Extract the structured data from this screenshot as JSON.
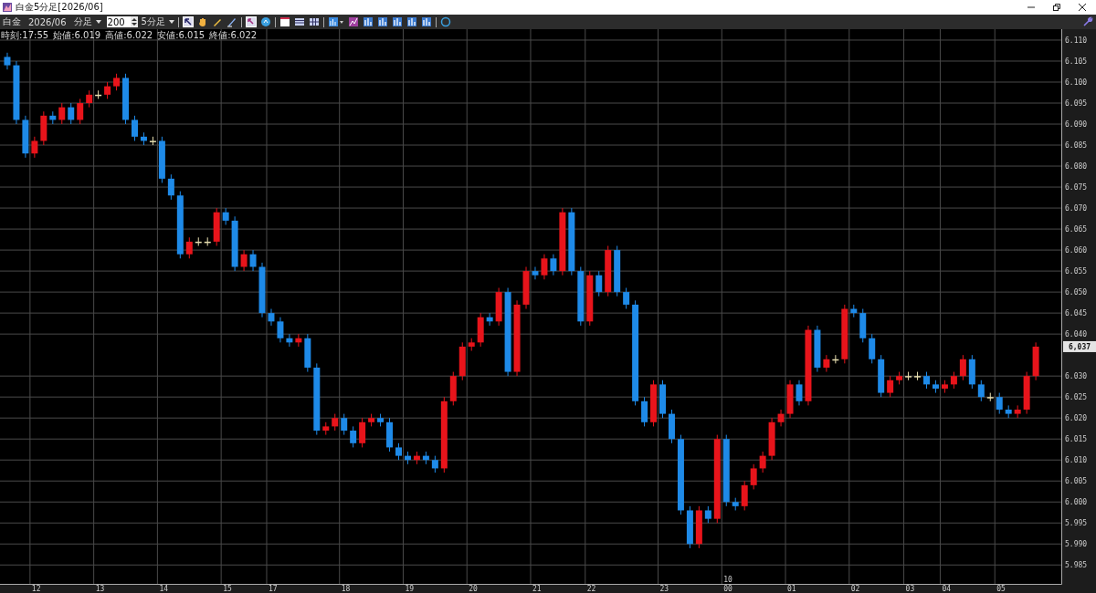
{
  "window": {
    "title": "白金5分足[2026/06]"
  },
  "toolbar": {
    "symbol": "白金",
    "contract": "2026/06",
    "period_unit": "分足",
    "bar_count": "200",
    "period": "5分足"
  },
  "info": [
    "時刻:17:55",
    "始値:6.019",
    "高値:6.022",
    "安値:6.015",
    "終値:6.022"
  ],
  "chart": {
    "last_price": "6,037",
    "chart_data": {
      "type": "candlestick",
      "grid": true,
      "categories": [
        null,
        null,
        null,
        "12",
        null,
        null,
        null,
        null,
        null,
        null,
        "13",
        null,
        null,
        null,
        null,
        null,
        null,
        "14",
        null,
        null,
        null,
        null,
        null,
        null,
        "15",
        null,
        null,
        null,
        null,
        "17",
        null,
        null,
        null,
        null,
        null,
        null,
        null,
        "18",
        null,
        null,
        null,
        null,
        null,
        null,
        "19",
        null,
        null,
        null,
        null,
        null,
        null,
        "20",
        null,
        null,
        null,
        null,
        null,
        null,
        "21",
        null,
        null,
        null,
        null,
        null,
        "22",
        null,
        null,
        null,
        null,
        null,
        null,
        null,
        "23",
        null,
        null,
        null,
        null,
        null,
        null,
        "00",
        null,
        null,
        null,
        null,
        null,
        null,
        "01",
        null,
        null,
        null,
        null,
        null,
        null,
        "02",
        null,
        null,
        null,
        null,
        null,
        "03",
        null,
        null,
        null,
        "04",
        null,
        null,
        null,
        null,
        null,
        "05",
        null,
        null,
        null,
        null
      ],
      "ohlc": [
        [
          6.106,
          6.107,
          6.103,
          6.104
        ],
        [
          6.104,
          6.105,
          6.09,
          6.091
        ],
        [
          6.091,
          6.092,
          6.082,
          6.083
        ],
        [
          6.083,
          6.087,
          6.082,
          6.086
        ],
        [
          6.086,
          6.093,
          6.085,
          6.092
        ],
        [
          6.092,
          6.093,
          6.09,
          6.091
        ],
        [
          6.091,
          6.095,
          6.09,
          6.094
        ],
        [
          6.094,
          6.095,
          6.09,
          6.091
        ],
        [
          6.091,
          6.096,
          6.09,
          6.095
        ],
        [
          6.095,
          6.098,
          6.094,
          6.097
        ],
        [
          6.097,
          6.098,
          6.096,
          6.097
        ],
        [
          6.097,
          6.1,
          6.096,
          6.099
        ],
        [
          6.099,
          6.102,
          6.098,
          6.101
        ],
        [
          6.101,
          6.102,
          6.09,
          6.091
        ],
        [
          6.091,
          6.092,
          6.086,
          6.087
        ],
        [
          6.087,
          6.088,
          6.085,
          6.086
        ],
        [
          6.086,
          6.087,
          6.085,
          6.086
        ],
        [
          6.086,
          6.087,
          6.076,
          6.077
        ],
        [
          6.077,
          6.078,
          6.072,
          6.073
        ],
        [
          6.073,
          6.074,
          6.058,
          6.059
        ],
        [
          6.059,
          6.063,
          6.058,
          6.062
        ],
        [
          6.062,
          6.063,
          6.061,
          6.062
        ],
        [
          6.062,
          6.063,
          6.061,
          6.062
        ],
        [
          6.062,
          6.07,
          6.061,
          6.069
        ],
        [
          6.069,
          6.07,
          6.066,
          6.067
        ],
        [
          6.067,
          6.068,
          6.055,
          6.056
        ],
        [
          6.056,
          6.06,
          6.055,
          6.059
        ],
        [
          6.059,
          6.06,
          6.055,
          6.056
        ],
        [
          6.056,
          6.057,
          6.044,
          6.045
        ],
        [
          6.045,
          6.046,
          6.042,
          6.043
        ],
        [
          6.043,
          6.044,
          6.038,
          6.039
        ],
        [
          6.039,
          6.04,
          6.037,
          6.038
        ],
        [
          6.038,
          6.04,
          6.037,
          6.039
        ],
        [
          6.039,
          6.04,
          6.031,
          6.032
        ],
        [
          6.032,
          6.033,
          6.016,
          6.017
        ],
        [
          6.017,
          6.019,
          6.016,
          6.018
        ],
        [
          6.018,
          6.021,
          6.017,
          6.02
        ],
        [
          6.02,
          6.021,
          6.016,
          6.017
        ],
        [
          6.017,
          6.018,
          6.013,
          6.014
        ],
        [
          6.014,
          6.02,
          6.013,
          6.019
        ],
        [
          6.019,
          6.021,
          6.018,
          6.02
        ],
        [
          6.02,
          6.021,
          6.018,
          6.019
        ],
        [
          6.019,
          6.02,
          6.012,
          6.013
        ],
        [
          6.013,
          6.014,
          6.01,
          6.011
        ],
        [
          6.011,
          6.012,
          6.009,
          6.01
        ],
        [
          6.01,
          6.012,
          6.009,
          6.011
        ],
        [
          6.011,
          6.012,
          6.009,
          6.01
        ],
        [
          6.01,
          6.011,
          6.007,
          6.008
        ],
        [
          6.008,
          6.025,
          6.007,
          6.024
        ],
        [
          6.024,
          6.031,
          6.023,
          6.03
        ],
        [
          6.03,
          6.038,
          6.029,
          6.037
        ],
        [
          6.037,
          6.039,
          6.036,
          6.038
        ],
        [
          6.038,
          6.045,
          6.037,
          6.044
        ],
        [
          6.044,
          6.045,
          6.042,
          6.043
        ],
        [
          6.043,
          6.051,
          6.042,
          6.05
        ],
        [
          6.05,
          6.051,
          6.03,
          6.031
        ],
        [
          6.031,
          6.048,
          6.03,
          6.047
        ],
        [
          6.047,
          6.056,
          6.046,
          6.055
        ],
        [
          6.055,
          6.056,
          6.053,
          6.054
        ],
        [
          6.054,
          6.059,
          6.053,
          6.058
        ],
        [
          6.058,
          6.059,
          6.054,
          6.055
        ],
        [
          6.055,
          6.07,
          6.054,
          6.069
        ],
        [
          6.069,
          6.07,
          6.054,
          6.055
        ],
        [
          6.055,
          6.056,
          6.042,
          6.043
        ],
        [
          6.043,
          6.055,
          6.042,
          6.054
        ],
        [
          6.054,
          6.055,
          6.049,
          6.05
        ],
        [
          6.05,
          6.061,
          6.049,
          6.06
        ],
        [
          6.06,
          6.061,
          6.049,
          6.05
        ],
        [
          6.05,
          6.051,
          6.046,
          6.047
        ],
        [
          6.047,
          6.048,
          6.023,
          6.024
        ],
        [
          6.024,
          6.025,
          6.018,
          6.019
        ],
        [
          6.019,
          6.029,
          6.018,
          6.028
        ],
        [
          6.028,
          6.029,
          6.02,
          6.021
        ],
        [
          6.021,
          6.022,
          6.014,
          6.015
        ],
        [
          6.015,
          6.016,
          5.997,
          5.998
        ],
        [
          5.998,
          5.999,
          5.989,
          5.99
        ],
        [
          5.99,
          5.999,
          5.989,
          5.998
        ],
        [
          5.998,
          5.999,
          5.995,
          5.996
        ],
        [
          5.996,
          6.016,
          5.995,
          6.015
        ],
        [
          6.015,
          6.016,
          5.999,
          6.0
        ],
        [
          6.0,
          6.001,
          5.998,
          5.999
        ],
        [
          5.999,
          6.005,
          5.998,
          6.004
        ],
        [
          6.004,
          6.009,
          6.003,
          6.008
        ],
        [
          6.008,
          6.012,
          6.007,
          6.011
        ],
        [
          6.011,
          6.02,
          6.01,
          6.019
        ],
        [
          6.019,
          6.022,
          6.018,
          6.021
        ],
        [
          6.021,
          6.029,
          6.02,
          6.028
        ],
        [
          6.028,
          6.029,
          6.023,
          6.024
        ],
        [
          6.024,
          6.042,
          6.023,
          6.041
        ],
        [
          6.041,
          6.042,
          6.031,
          6.032
        ],
        [
          6.032,
          6.035,
          6.031,
          6.034
        ],
        [
          6.034,
          6.035,
          6.033,
          6.034
        ],
        [
          6.034,
          6.047,
          6.033,
          6.046
        ],
        [
          6.046,
          6.047,
          6.044,
          6.045
        ],
        [
          6.045,
          6.046,
          6.038,
          6.039
        ],
        [
          6.039,
          6.04,
          6.033,
          6.034
        ],
        [
          6.034,
          6.035,
          6.025,
          6.026
        ],
        [
          6.026,
          6.03,
          6.025,
          6.029
        ],
        [
          6.029,
          6.031,
          6.028,
          6.03
        ],
        [
          6.03,
          6.031,
          6.029,
          6.03
        ],
        [
          6.03,
          6.031,
          6.029,
          6.03
        ],
        [
          6.03,
          6.031,
          6.027,
          6.028
        ],
        [
          6.028,
          6.029,
          6.026,
          6.027
        ],
        [
          6.027,
          6.029,
          6.026,
          6.028
        ],
        [
          6.028,
          6.031,
          6.027,
          6.03
        ],
        [
          6.03,
          6.035,
          6.029,
          6.034
        ],
        [
          6.034,
          6.035,
          6.027,
          6.028
        ],
        [
          6.028,
          6.029,
          6.024,
          6.025
        ],
        [
          6.025,
          6.026,
          6.024,
          6.025
        ],
        [
          6.025,
          6.026,
          6.021,
          6.022
        ],
        [
          6.022,
          6.023,
          6.02,
          6.021
        ],
        [
          6.021,
          6.023,
          6.02,
          6.022
        ],
        [
          6.022,
          6.031,
          6.021,
          6.03
        ],
        [
          6.03,
          6.038,
          6.029,
          6.037
        ]
      ],
      "ylim": [
        5.9805,
        6.1126
      ],
      "yticks": [
        {
          "value": 6.11,
          "label": "6.110"
        },
        {
          "value": 6.105,
          "label": "6.105"
        },
        {
          "value": 6.1,
          "label": "6.100"
        },
        {
          "value": 6.095,
          "label": "6.095"
        },
        {
          "value": 6.09,
          "label": "6.090"
        },
        {
          "value": 6.085,
          "label": "6.085"
        },
        {
          "value": 6.08,
          "label": "6.080"
        },
        {
          "value": 6.075,
          "label": "6.075"
        },
        {
          "value": 6.07,
          "label": "6.070"
        },
        {
          "value": 6.065,
          "label": "6.065"
        },
        {
          "value": 6.06,
          "label": "6.060"
        },
        {
          "value": 6.055,
          "label": "6.055"
        },
        {
          "value": 6.05,
          "label": "6.050"
        },
        {
          "value": 6.045,
          "label": "6.045"
        },
        {
          "value": 6.04,
          "label": "6.040"
        },
        {
          "value": 6.03,
          "label": "6.030"
        },
        {
          "value": 6.025,
          "label": "6.025"
        },
        {
          "value": 6.02,
          "label": "6.020"
        },
        {
          "value": 6.015,
          "label": "6.015"
        },
        {
          "value": 6.01,
          "label": "6.010"
        },
        {
          "value": 6.005,
          "label": "6.005"
        },
        {
          "value": 6.0,
          "label": "6.000"
        },
        {
          "value": 5.995,
          "label": "5.995"
        },
        {
          "value": 5.99,
          "label": "5.990"
        },
        {
          "value": 5.985,
          "label": "5.985"
        }
      ],
      "annotations": [
        "10"
      ]
    }
  }
}
